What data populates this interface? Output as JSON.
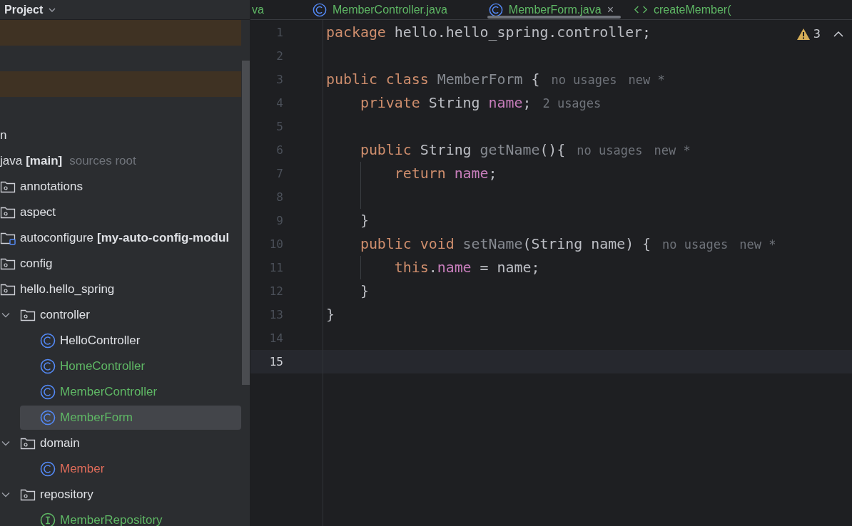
{
  "sidebar": {
    "title": "Project",
    "tree": [
      {
        "highlighted": true,
        "selected": false
      },
      {
        "highlighted": true,
        "selected": false
      },
      {
        "label": "n",
        "highlighted": false,
        "selected": false,
        "children": [
          {
            "label": "java",
            "tag": "[main]",
            "note": "sources root",
            "highlighted": false,
            "selected": false,
            "children": [
              {
                "label": "annotations",
                "kind": "package",
                "highlighted": false,
                "selected": false
              },
              {
                "label": "aspect",
                "kind": "package",
                "highlighted": false,
                "selected": false
              },
              {
                "label": "autoconfigure",
                "tag": "[my-auto-config-modul",
                "kind": "module",
                "highlighted": false,
                "selected": false
              },
              {
                "label": "config",
                "kind": "package",
                "highlighted": false,
                "selected": false
              },
              {
                "label": "hello.hello_spring",
                "kind": "package",
                "highlighted": false,
                "selected": false,
                "children": [
                  {
                    "label": "controller",
                    "kind": "package",
                    "expanded": true,
                    "highlighted": false,
                    "selected": false,
                    "children": [
                      {
                        "label": "HelloController",
                        "kind": "class",
                        "color": "#dfe1e5",
                        "highlighted": false,
                        "selected": false
                      },
                      {
                        "label": "HomeController",
                        "kind": "class",
                        "color": "#5fb865",
                        "highlighted": false,
                        "selected": false
                      },
                      {
                        "label": "MemberController",
                        "kind": "class",
                        "color": "#5fb865",
                        "highlighted": false,
                        "selected": false
                      },
                      {
                        "label": "MemberForm",
                        "kind": "class",
                        "color": "#5fb865",
                        "highlighted": false,
                        "selected": true
                      }
                    ]
                  },
                  {
                    "label": "domain",
                    "kind": "package",
                    "expanded": true,
                    "highlighted": false,
                    "selected": false,
                    "children": [
                      {
                        "label": "Member",
                        "kind": "class",
                        "color": "#e06c5a",
                        "highlighted": false,
                        "selected": false
                      }
                    ]
                  },
                  {
                    "label": "repository",
                    "kind": "package",
                    "expanded": true,
                    "highlighted": false,
                    "selected": false,
                    "children": [
                      {
                        "label": "MemberRepository",
                        "kind": "interface",
                        "color": "#5fb865",
                        "highlighted": false,
                        "selected": false
                      }
                    ]
                  }
                ]
              }
            ]
          }
        ]
      }
    ]
  },
  "tabs": [
    {
      "label": "va",
      "selected": false
    },
    {
      "label": "MemberController.java",
      "kind": "class",
      "selected": false
    },
    {
      "label": "MemberForm.java",
      "kind": "class",
      "selected": true,
      "close": "×"
    },
    {
      "label": "createMember(",
      "kind": "method",
      "selected": false
    }
  ],
  "inspections": {
    "warnings": "3"
  },
  "editor": {
    "lines": [
      {
        "number": "1",
        "current": false,
        "guide": false,
        "tokens": [
          {
            "kind": "keyword",
            "text": "package "
          },
          {
            "kind": "plain",
            "text": "hello.hello_spring.controller;"
          }
        ]
      },
      {
        "number": "2",
        "current": false,
        "guide": false
      },
      {
        "number": "3",
        "current": false,
        "guide": false,
        "tokens": [
          {
            "kind": "keyword",
            "text": "public class "
          },
          {
            "kind": "unused",
            "text": "MemberForm"
          },
          {
            "kind": "plain",
            "text": " {"
          },
          {
            "kind": "hint",
            "text": "no usages"
          },
          {
            "kind": "hint",
            "text": "new *"
          }
        ]
      },
      {
        "number": "4",
        "current": false,
        "guide": false,
        "tokens": [
          {
            "kind": "keyword",
            "text": "    private "
          },
          {
            "kind": "plain",
            "text": "String "
          },
          {
            "kind": "field",
            "text": "name"
          },
          {
            "kind": "plain",
            "text": ";"
          },
          {
            "kind": "hint",
            "text": "2 usages"
          }
        ]
      },
      {
        "number": "5",
        "current": false,
        "guide": false
      },
      {
        "number": "6",
        "current": false,
        "guide": false,
        "tokens": [
          {
            "kind": "keyword",
            "text": "    public "
          },
          {
            "kind": "plain",
            "text": "String "
          },
          {
            "kind": "unused",
            "text": "getName"
          },
          {
            "kind": "plain",
            "text": "(){"
          },
          {
            "kind": "hint",
            "text": "no usages"
          },
          {
            "kind": "hint",
            "text": "new *"
          }
        ]
      },
      {
        "number": "7",
        "current": false,
        "guide": true,
        "tokens": [
          {
            "kind": "keyword",
            "text": "        return "
          },
          {
            "kind": "field",
            "text": "name"
          },
          {
            "kind": "plain",
            "text": ";"
          }
        ]
      },
      {
        "number": "8",
        "current": false,
        "guide": true
      },
      {
        "number": "9",
        "current": false,
        "guide": false,
        "tokens": [
          {
            "kind": "plain",
            "text": "    }"
          }
        ]
      },
      {
        "number": "10",
        "current": false,
        "guide": false,
        "tokens": [
          {
            "kind": "keyword",
            "text": "    public void "
          },
          {
            "kind": "unused",
            "text": "setName"
          },
          {
            "kind": "plain",
            "text": "(String name) {"
          },
          {
            "kind": "hint",
            "text": "no usages"
          },
          {
            "kind": "hint",
            "text": "new *"
          }
        ]
      },
      {
        "number": "11",
        "current": false,
        "guide": true,
        "tokens": [
          {
            "kind": "keyword",
            "text": "        this"
          },
          {
            "kind": "plain",
            "text": "."
          },
          {
            "kind": "field",
            "text": "name"
          },
          {
            "kind": "plain",
            "text": " = name;"
          }
        ]
      },
      {
        "number": "12",
        "current": false,
        "guide": false,
        "tokens": [
          {
            "kind": "plain",
            "text": "    }"
          }
        ]
      },
      {
        "number": "13",
        "current": false,
        "guide": false,
        "tokens": [
          {
            "kind": "plain",
            "text": "}"
          }
        ]
      },
      {
        "number": "14",
        "current": false,
        "guide": false
      },
      {
        "number": "15",
        "current": true,
        "guide": false
      }
    ]
  }
}
